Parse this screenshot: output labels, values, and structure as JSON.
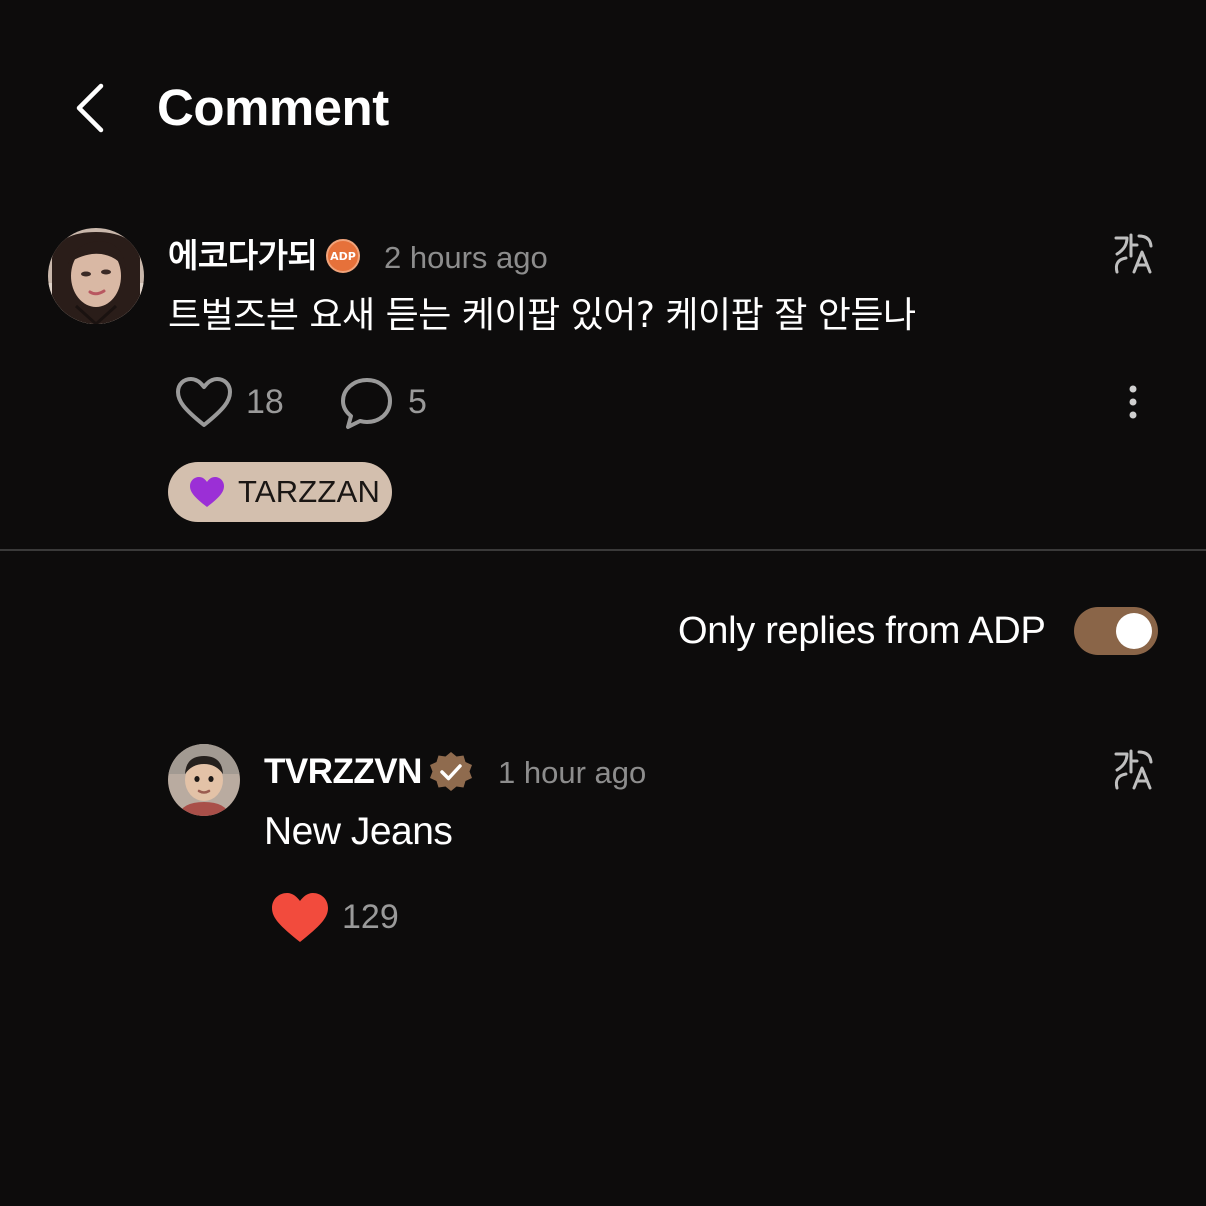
{
  "header": {
    "title": "Comment",
    "back_icon": "chevron-left-icon"
  },
  "comment": {
    "username": "에코다가되",
    "badge_text": "ADP",
    "timestamp": "2 hours ago",
    "text": "트벌즈븐 요새 듣는 케이팝 있어? 케이팝 잘 안듣나",
    "likes": "18",
    "replies": "5",
    "tag_label": "TARZZAN",
    "tag_color": "#9b2fd6",
    "translate_icon": "translate-icon",
    "more_icon": "more-vertical-icon"
  },
  "filter": {
    "label": "Only replies from ADP",
    "enabled": true,
    "toggle_color": "#8a6548"
  },
  "reply": {
    "username": "TVRZZVN",
    "verified": true,
    "timestamp": "1 hour ago",
    "text": "New Jeans",
    "likes": "129",
    "liked": true,
    "like_color": "#f24b3d"
  },
  "colors": {
    "background": "#0d0c0c",
    "chip": "#d3bfae",
    "verified_badge": "#8f6b4e",
    "adp_badge": "#e6713a"
  }
}
